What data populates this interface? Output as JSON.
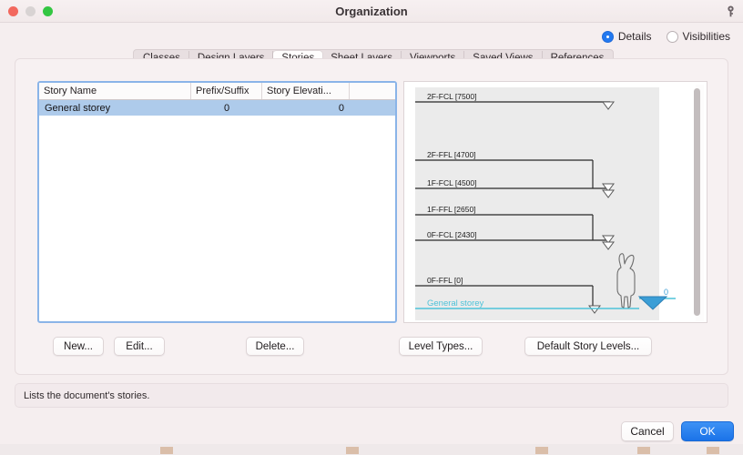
{
  "window": {
    "title": "Organization",
    "help_icon": "help-key-icon",
    "controls": [
      "close",
      "minimize",
      "zoom"
    ]
  },
  "view_mode": {
    "options": [
      {
        "label": "Details",
        "selected": true
      },
      {
        "label": "Visibilities",
        "selected": false
      }
    ]
  },
  "tabs": [
    {
      "label": "Classes",
      "active": false
    },
    {
      "label": "Design Layers",
      "active": false
    },
    {
      "label": "Stories",
      "active": true
    },
    {
      "label": "Sheet Layers",
      "active": false
    },
    {
      "label": "Viewports",
      "active": false
    },
    {
      "label": "Saved Views",
      "active": false
    },
    {
      "label": "References",
      "active": false
    }
  ],
  "table": {
    "columns": [
      "Story Name",
      "Prefix/Suffix",
      "Story Elevati...",
      ""
    ],
    "rows": [
      {
        "story_name": "General storey",
        "prefix_suffix": "0",
        "story_elevation": "0",
        "extra": "",
        "selected": true
      }
    ]
  },
  "preview": {
    "type": "story-level-elevation-diagram",
    "selected_story_label": "General storey",
    "ground_marker_value": "0",
    "levels": [
      {
        "label": "2F-FCL [7500]",
        "value": 7500
      },
      {
        "label": "2F-FFL [4700]",
        "value": 4700
      },
      {
        "label": "1F-FCL [4500]",
        "value": 4500
      },
      {
        "label": "1F-FFL [2650]",
        "value": 2650
      },
      {
        "label": "0F-FCL [2430]",
        "value": 2430
      },
      {
        "label": "0F-FFL [0]",
        "value": 0
      }
    ]
  },
  "actions": {
    "new": "New...",
    "edit": "Edit...",
    "delete": "Delete...",
    "level_types": "Level Types...",
    "default_story_levels": "Default Story Levels..."
  },
  "status": {
    "message": "Lists the document's stories."
  },
  "footer": {
    "cancel": "Cancel",
    "ok": "OK"
  },
  "colors": {
    "accent": "#1b73e8",
    "selection": "#aecbeb",
    "focus_border": "#8ab4e8",
    "story_line": "#4ec3d9",
    "window_bg": "#f5eeef"
  }
}
